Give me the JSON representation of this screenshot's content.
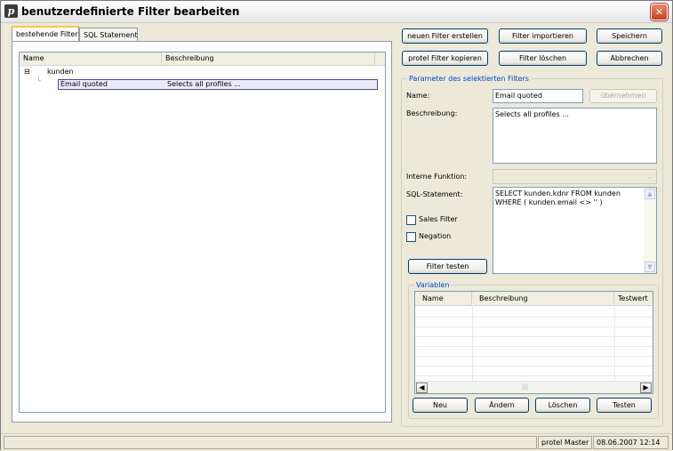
{
  "window": {
    "title": "benutzerdefinierte Filter bearbeiten",
    "app_icon_letter": "p"
  },
  "tabs": [
    {
      "label": "bestehende Filter",
      "active": true
    },
    {
      "label": "SQL Statement",
      "active": false
    }
  ],
  "tree": {
    "columns": [
      "Name",
      "Beschreibung"
    ],
    "root": {
      "label": "kunden",
      "expander": "⊟"
    },
    "items": [
      {
        "name": "Email quoted",
        "description": "Selects all profiles ...",
        "selected": true
      }
    ]
  },
  "toolbar": {
    "new_filter": "neuen Filter erstellen",
    "import_filter": "Filter importieren",
    "save": "Speichern",
    "copy_protel": "protel Filter kopieren",
    "delete_filter": "Filter löschen",
    "cancel": "Abbrechen"
  },
  "params": {
    "legend": "Parameter des selektierten Filters",
    "name_label": "Name:",
    "name_value": "Email quoted",
    "apply_button": "übernehmen",
    "description_label": "Beschreibung:",
    "description_value": "Selects all profiles ...",
    "internal_function_label": "Interne Funktion:",
    "internal_function_value": "",
    "sql_label": "SQL-Statement:",
    "sql_value": "SELECT kunden.kdnr FROM kunden WHERE ( kunden.email <> '' )",
    "sales_filter_label": "Sales Filter",
    "sales_filter_checked": false,
    "negation_label": "Negation",
    "negation_checked": false,
    "test_filter_button": "Filter testen"
  },
  "variables": {
    "legend": "Variablen",
    "columns": [
      "Name",
      "Beschreibung",
      "Testwert"
    ],
    "rows": [],
    "buttons": {
      "new": "Neu",
      "change": "Ändern",
      "delete": "Löschen",
      "test": "Testen"
    }
  },
  "status": {
    "user": "protel Master",
    "datetime": "08.06.2007 12:14"
  },
  "colors": {
    "window_bg": "#ece9d8",
    "legend_blue": "#0046d5",
    "tab_highlight": "#ffc83c",
    "close_red": "#c7401c"
  }
}
